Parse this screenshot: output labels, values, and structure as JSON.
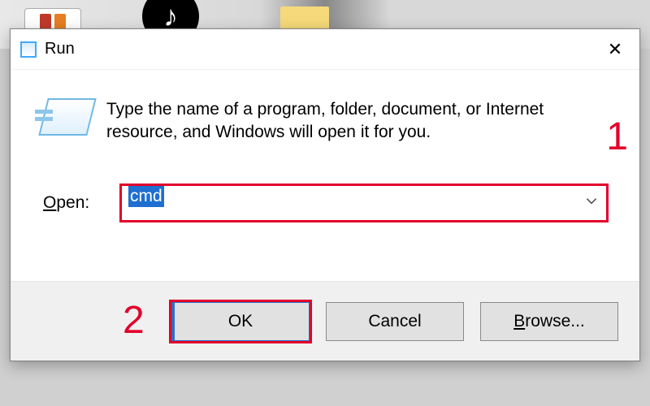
{
  "desktop": {
    "tiktok_glyph": "♪"
  },
  "dialog": {
    "title": "Run",
    "close_glyph": "✕",
    "description": "Type the name of a program, folder, document, or Internet resource, and Windows will open it for you.",
    "open_label_prefix": "O",
    "open_label_rest": "pen:",
    "input_value": "cmd",
    "buttons": {
      "ok": "OK",
      "cancel": "Cancel",
      "browse_prefix": "B",
      "browse_rest": "rowse..."
    }
  },
  "annotations": {
    "one": "1",
    "two": "2"
  }
}
